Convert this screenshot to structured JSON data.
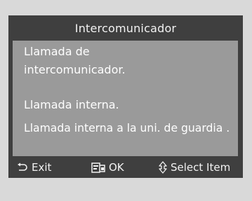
{
  "dialog": {
    "title": "Intercomunicador",
    "messages": [
      "Llamada de",
      "intercomunicador.",
      "Llamada interna.",
      "Llamada interna a la uni. de guardia ."
    ]
  },
  "footer": {
    "exit": {
      "label": "Exit",
      "icon": "return-arrow-icon"
    },
    "ok": {
      "label": "OK",
      "icon": "enter-icon"
    },
    "select": {
      "label": "Select Item",
      "icon": "up-down-arrow-icon"
    }
  },
  "colors": {
    "page_background": "#d9d9d9",
    "menu_background": "#3f3f3f",
    "content_background": "#9a9a9a",
    "text": "#ffffff"
  }
}
